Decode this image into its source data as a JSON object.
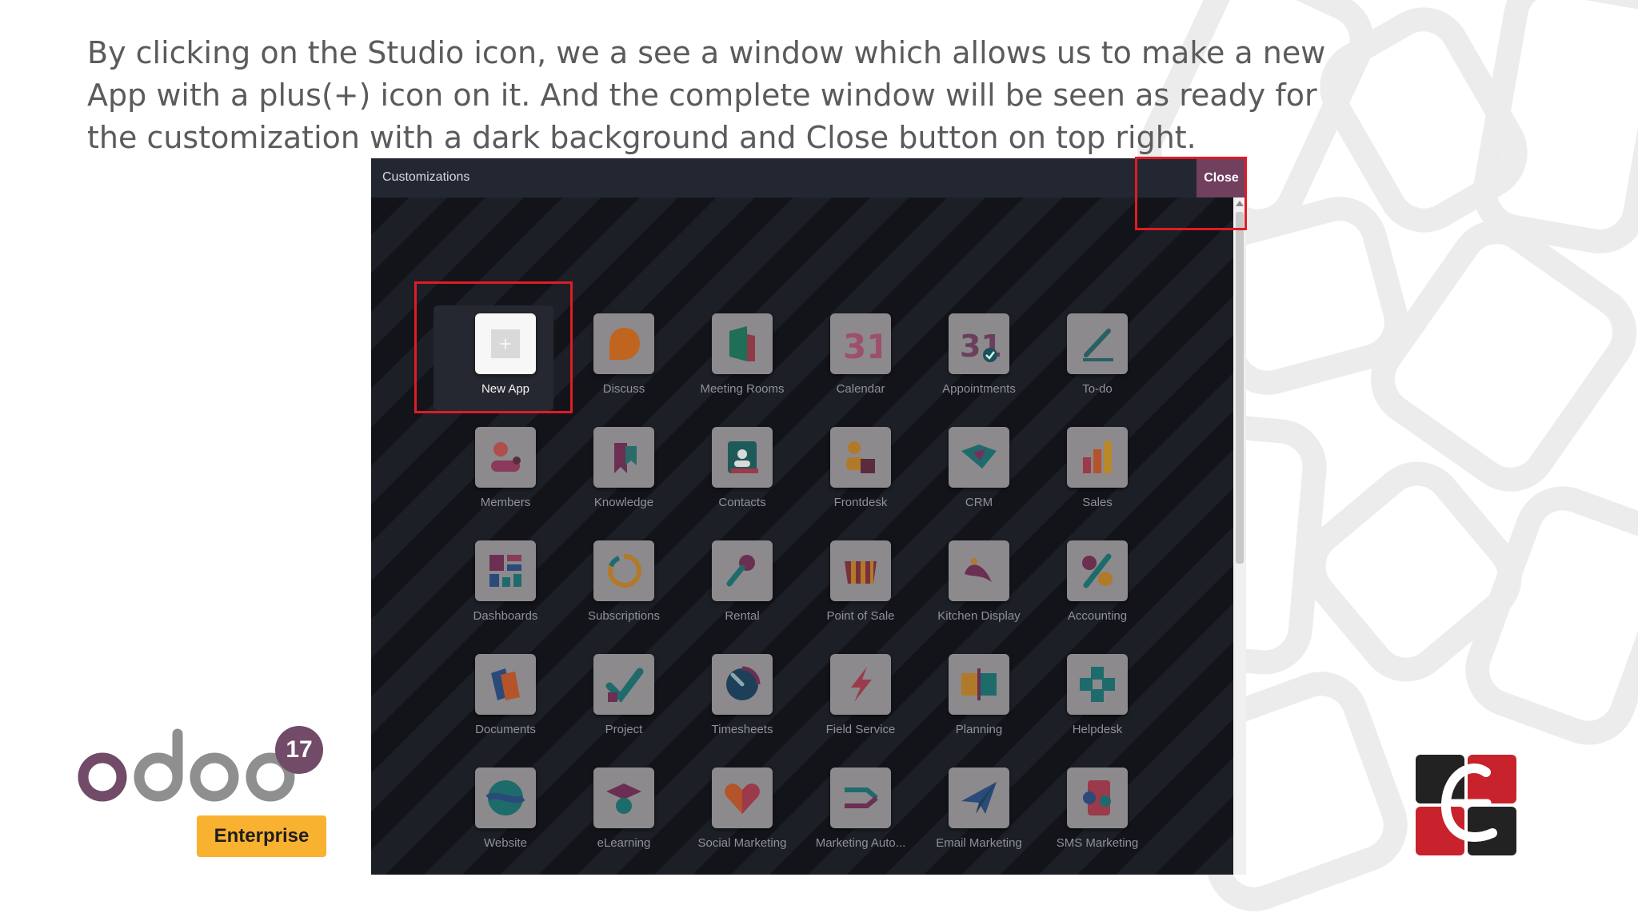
{
  "caption": "By clicking on the Studio icon, we a see a window which allows us to make a new App with a plus(+) icon on it. And the complete window will be seen as ready for the customization with a dark background and Close button on top right.",
  "window": {
    "title": "Customizations",
    "close_label": "Close"
  },
  "apps": [
    {
      "label": "New App",
      "icon": "plus-icon"
    },
    {
      "label": "Discuss",
      "icon": "discuss-icon"
    },
    {
      "label": "Meeting Rooms",
      "icon": "meeting-rooms-icon"
    },
    {
      "label": "Calendar",
      "icon": "calendar-icon"
    },
    {
      "label": "Appointments",
      "icon": "appointments-icon"
    },
    {
      "label": "To-do",
      "icon": "todo-icon"
    },
    {
      "label": "Members",
      "icon": "members-icon"
    },
    {
      "label": "Knowledge",
      "icon": "knowledge-icon"
    },
    {
      "label": "Contacts",
      "icon": "contacts-icon"
    },
    {
      "label": "Frontdesk",
      "icon": "frontdesk-icon"
    },
    {
      "label": "CRM",
      "icon": "crm-icon"
    },
    {
      "label": "Sales",
      "icon": "sales-icon"
    },
    {
      "label": "Dashboards",
      "icon": "dashboards-icon"
    },
    {
      "label": "Subscriptions",
      "icon": "subscriptions-icon"
    },
    {
      "label": "Rental",
      "icon": "rental-icon"
    },
    {
      "label": "Point of Sale",
      "icon": "point-of-sale-icon"
    },
    {
      "label": "Kitchen Display",
      "icon": "kitchen-display-icon"
    },
    {
      "label": "Accounting",
      "icon": "accounting-icon"
    },
    {
      "label": "Documents",
      "icon": "documents-icon"
    },
    {
      "label": "Project",
      "icon": "project-icon"
    },
    {
      "label": "Timesheets",
      "icon": "timesheets-icon"
    },
    {
      "label": "Field Service",
      "icon": "field-service-icon"
    },
    {
      "label": "Planning",
      "icon": "planning-icon"
    },
    {
      "label": "Helpdesk",
      "icon": "helpdesk-icon"
    },
    {
      "label": "Website",
      "icon": "website-icon"
    },
    {
      "label": "eLearning",
      "icon": "elearning-icon"
    },
    {
      "label": "Social Marketing",
      "icon": "social-marketing-icon"
    },
    {
      "label": "Marketing Auto...",
      "icon": "marketing-automation-icon"
    },
    {
      "label": "Email Marketing",
      "icon": "email-marketing-icon"
    },
    {
      "label": "SMS Marketing",
      "icon": "sms-marketing-icon"
    }
  ],
  "logo": {
    "wordmark": "odoo",
    "version": "17",
    "edition": "Enterprise"
  },
  "colors": {
    "accent": "#714b67",
    "highlight": "#e01b24",
    "enterprise": "#f9b130"
  }
}
